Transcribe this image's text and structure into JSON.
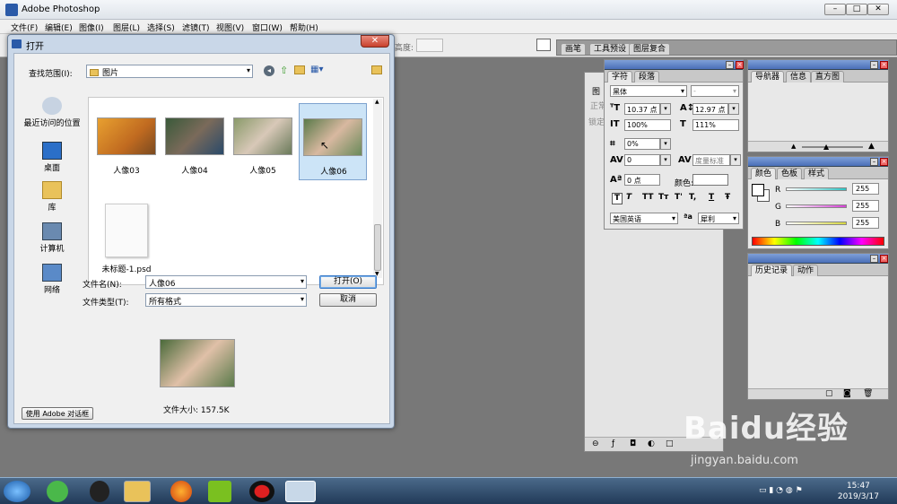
{
  "app": {
    "title": "Adobe Photoshop"
  },
  "menubar": [
    "文件(F)",
    "编辑(E)",
    "图像(I)",
    "图层(L)",
    "选择(S)",
    "滤镜(T)",
    "视图(V)",
    "窗口(W)",
    "帮助(H)"
  ],
  "options_bar": {
    "height_label": "高度:",
    "tabs": [
      "画笔",
      "工具预设",
      "图层复合"
    ]
  },
  "open_dialog": {
    "title": "打开",
    "lookin_label": "查找范围(I):",
    "lookin_value": "图片",
    "places": [
      "最近访问的位置",
      "桌面",
      "库",
      "计算机",
      "网络"
    ],
    "files": [
      "人像03",
      "人像04",
      "人像05",
      "人像06",
      "未标题-1.psd"
    ],
    "selected_file": "人像06",
    "filename_label": "文件名(N):",
    "filename_value": "人像06",
    "filetype_label": "文件类型(T):",
    "filetype_value": "所有格式",
    "open_button": "打开(O)",
    "cancel_button": "取消",
    "filesize": "文件大小: 157.5K",
    "use_adobe_button": "使用 Adobe 对话框"
  },
  "char_panel": {
    "tabs": [
      "字符",
      "段落"
    ],
    "font_family": "黑体",
    "font_style": "-",
    "font_size": "10.37 点",
    "leading": "12.97 点",
    "vscale": "100%",
    "hscale": "111%",
    "tracking_pct": "0%",
    "kerning": "0",
    "kerning_mode": "度量标准",
    "baseline": "0 点",
    "color_label": "颜色:",
    "style_buttons": [
      "T",
      "T",
      "TT",
      "Tт",
      "T'",
      "T,",
      "T",
      "Ŧ"
    ],
    "language": "美国英语",
    "aa_icon": "ªa",
    "antialias": "犀利"
  },
  "layers_panel": {
    "tab": "图",
    "row1": "正常",
    "row2": "锁定"
  },
  "navigator_panel": {
    "tabs": [
      "导航器",
      "信息",
      "直方图"
    ]
  },
  "color_panel": {
    "tabs": [
      "颜色",
      "色板",
      "样式"
    ],
    "channels": [
      {
        "name": "R",
        "value": "255",
        "color": "#2ec4c4"
      },
      {
        "name": "G",
        "value": "255",
        "color": "#d640d6"
      },
      {
        "name": "B",
        "value": "255",
        "color": "#d6d640"
      }
    ]
  },
  "history_panel": {
    "tabs": [
      "历史记录",
      "动作"
    ]
  },
  "taskbar": {
    "time": "15:47",
    "date": "2019/3/17"
  },
  "watermark": {
    "brand": "Baidu经验",
    "url": "jingyan.baidu.com"
  }
}
